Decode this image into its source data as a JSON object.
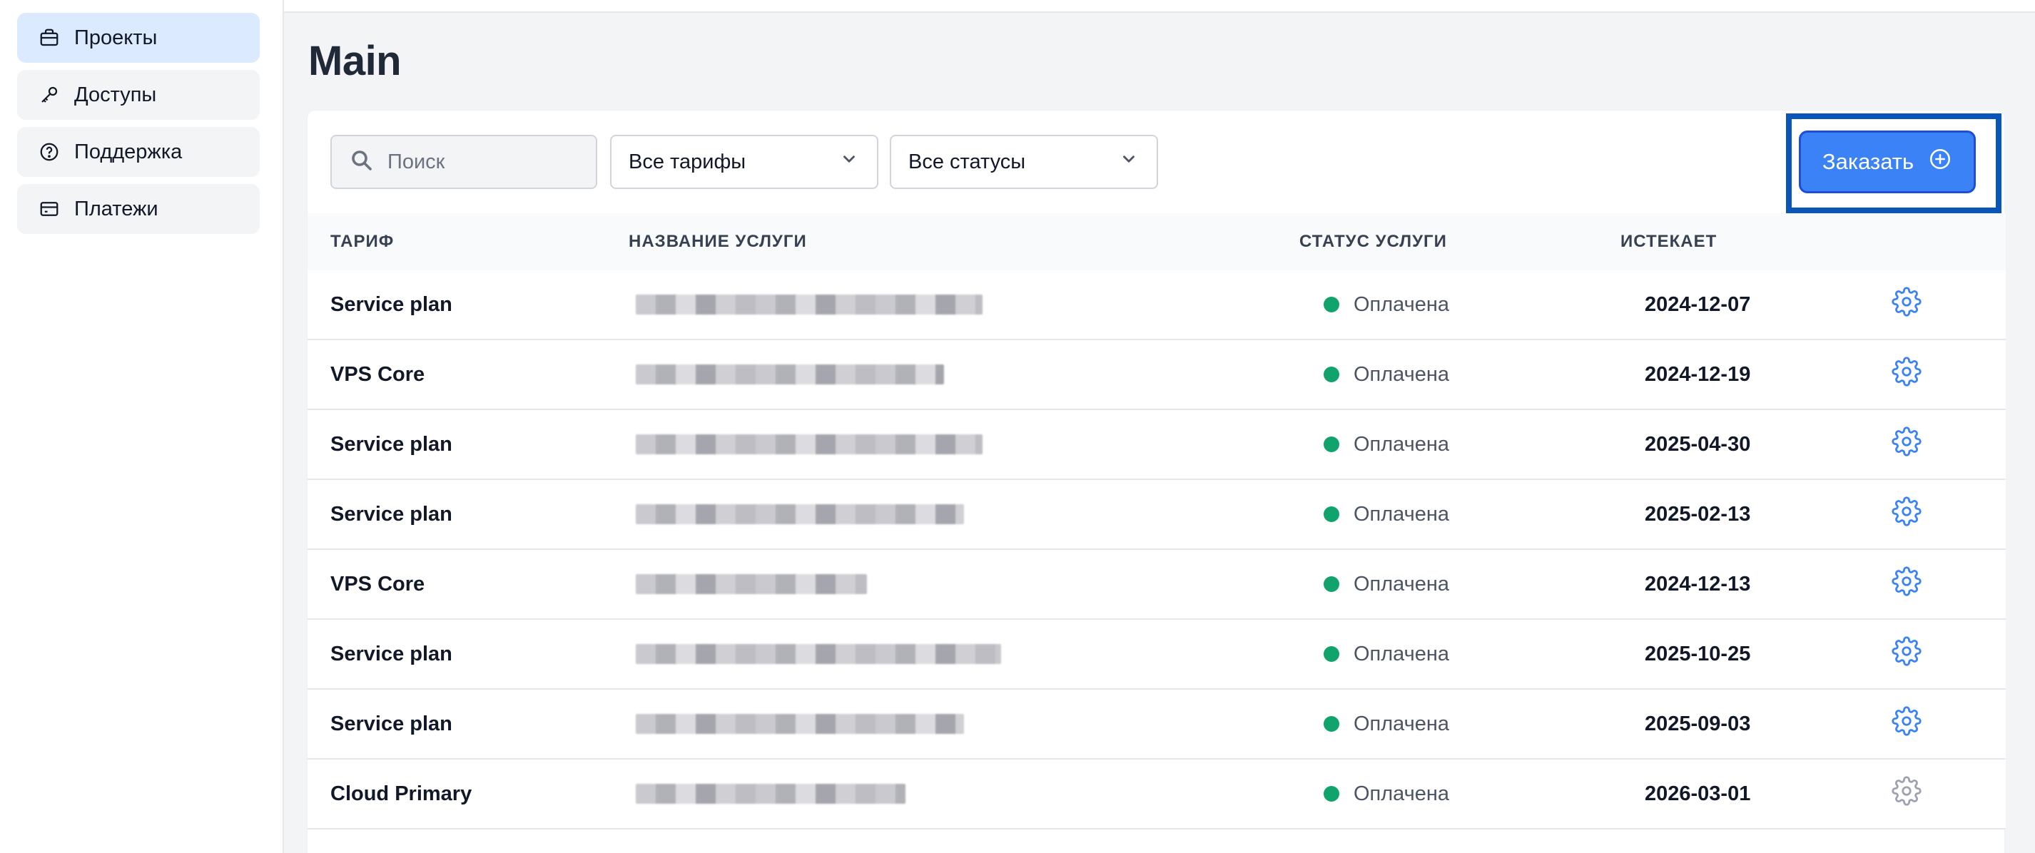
{
  "sidebar": {
    "items": [
      {
        "label": "Проекты",
        "icon": "briefcase-icon",
        "active": true
      },
      {
        "label": "Доступы",
        "icon": "key-icon",
        "active": false
      },
      {
        "label": "Поддержка",
        "icon": "help-circle-icon",
        "active": false
      },
      {
        "label": "Платежи",
        "icon": "credit-card-icon",
        "active": false
      }
    ]
  },
  "page": {
    "title": "Main"
  },
  "filters": {
    "search_placeholder": "Поиск",
    "tariff_select": "Все тарифы",
    "status_select": "Все статусы"
  },
  "order_button": {
    "label": "Заказать"
  },
  "table": {
    "columns": [
      "ТАРИФ",
      "НАЗВАНИЕ УСЛУГИ",
      "СТАТУС УСЛУГИ",
      "ИСТЕКАЕТ"
    ],
    "rows": [
      {
        "tariff": "Service plan",
        "status": "Оплачена",
        "expires": "2024-12-07"
      },
      {
        "tariff": "VPS Core",
        "status": "Оплачена",
        "expires": "2024-12-19"
      },
      {
        "tariff": "Service plan",
        "status": "Оплачена",
        "expires": "2025-04-30"
      },
      {
        "tariff": "Service plan",
        "status": "Оплачена",
        "expires": "2025-02-13"
      },
      {
        "tariff": "VPS Core",
        "status": "Оплачена",
        "expires": "2024-12-13"
      },
      {
        "tariff": "Service plan",
        "status": "Оплачена",
        "expires": "2025-10-25"
      },
      {
        "tariff": "Service plan",
        "status": "Оплачена",
        "expires": "2025-09-03"
      },
      {
        "tariff": "Cloud Primary",
        "status": "Оплачена",
        "expires": "2026-03-01"
      }
    ]
  },
  "colors": {
    "accent": "#3b82f6",
    "highlight_border": "#0a56b8",
    "status_paid": "#10a36b",
    "gear": "#3b82f6",
    "gear_muted": "#9ca3af"
  }
}
